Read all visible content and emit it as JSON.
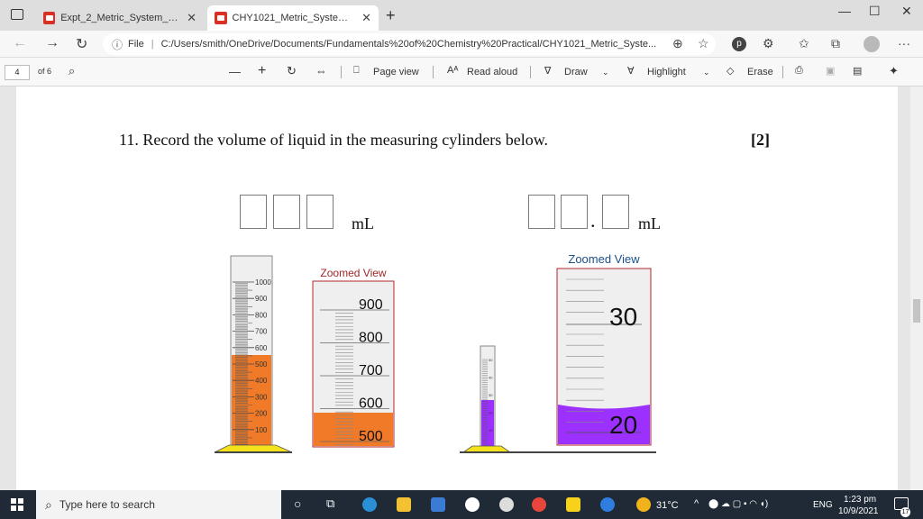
{
  "browser": {
    "tabs": [
      {
        "title": "Expt_2_Metric_System_Measurem",
        "active": false
      },
      {
        "title": "CHY1021_Metric_System_Measu",
        "active": true
      }
    ],
    "new_tab_glyph": "+",
    "url_label": "File",
    "url": "C:/Users/smith/OneDrive/Documents/Fundamentals%20of%20Chemistry%20Practical/CHY1021_Metric_Syste..."
  },
  "pdf_toolbar": {
    "page_number": "4",
    "page_total": "of 6",
    "zoom_out": "—",
    "zoom_in": "+",
    "page_view": "Page view",
    "read_aloud": "Read aloud",
    "draw": "Draw",
    "highlight": "Highlight",
    "erase": "Erase"
  },
  "document": {
    "question": "11. Record the volume of liquid in the measuring cylinders below.",
    "marks": "[2]",
    "answer1_unit": "mL",
    "answer2_unit": "mL",
    "answer2_point": ".",
    "cylinder1": {
      "zoom_title": "Zoomed View",
      "scale_labels": [
        "1000",
        "900",
        "800",
        "700",
        "600",
        "500",
        "400",
        "300",
        "200",
        "100"
      ],
      "zoom_labels": [
        "900",
        "800",
        "700",
        "600",
        "500"
      ],
      "liquid_level_ml": 540,
      "liquid_color": "#f07a27"
    },
    "cylinder2": {
      "zoom_title": "Zoomed View",
      "scale_labels": [
        "50",
        "40",
        "30",
        "20",
        "10"
      ],
      "zoom_labels": [
        "30",
        "20"
      ],
      "liquid_level_ml": 22,
      "liquid_color": "#9b30ff"
    }
  },
  "taskbar": {
    "search_placeholder": "Type here to search",
    "temperature": "31°C",
    "language": "ENG",
    "time": "1:23 pm",
    "date": "10/9/2021",
    "notifications": "17"
  },
  "colors": {
    "base_yellow": "#f5e11c",
    "zoom_title_red": "#a0282a",
    "zoom_title_blue": "#1a4f8c"
  }
}
